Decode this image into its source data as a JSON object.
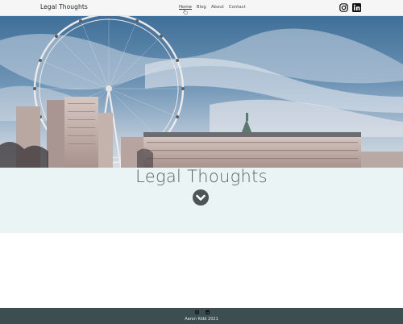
{
  "navbar": {
    "brand": "Legal Thoughts",
    "links": [
      {
        "label": "Home",
        "active": true
      },
      {
        "label": "Blog",
        "active": false
      },
      {
        "label": "About",
        "active": false
      },
      {
        "label": "Contact",
        "active": false
      }
    ],
    "social_icons": [
      "instagram-icon",
      "linkedin-icon"
    ]
  },
  "hero": {
    "image": "london-eye-county-hall-skyline",
    "title": "Legal Thoughts",
    "scroll_icon": "chevron-down-icon"
  },
  "footer": {
    "icons": [
      "instagram-icon",
      "linkedin-icon"
    ],
    "text": "Aaron Kidd 2021"
  },
  "colors": {
    "navbar_bg": "#f5f6f5",
    "title_band_bg": "#eaf4f4",
    "footer_bg": "#3c4e50",
    "scroll_button_bg": "#4d5558"
  }
}
